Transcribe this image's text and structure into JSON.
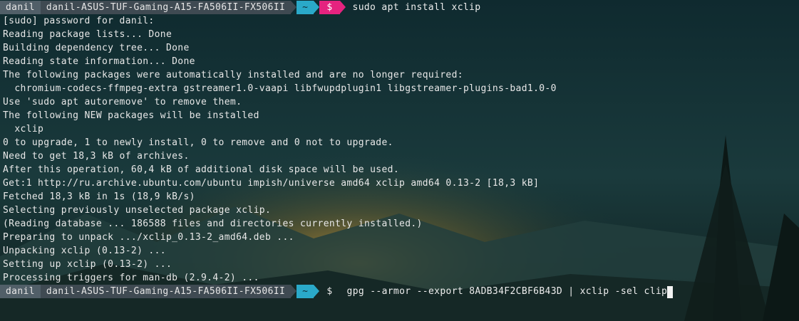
{
  "prompt": {
    "user": "danil",
    "host": "danil-ASUS-TUF-Gaming-A15-FA506II-FX506II",
    "dir": "~",
    "symbol": "$"
  },
  "commands": {
    "first": "sudo apt install xclip",
    "second": "gpg --armor --export 8ADB34F2CBF6B43D | xclip -sel clip"
  },
  "output": [
    "[sudo] password for danil:",
    "Reading package lists... Done",
    "Building dependency tree... Done",
    "Reading state information... Done",
    "The following packages were automatically installed and are no longer required:",
    "  chromium-codecs-ffmpeg-extra gstreamer1.0-vaapi libfwupdplugin1 libgstreamer-plugins-bad1.0-0",
    "Use 'sudo apt autoremove' to remove them.",
    "The following NEW packages will be installed",
    "  xclip",
    "0 to upgrade, 1 to newly install, 0 to remove and 0 not to upgrade.",
    "Need to get 18,3 kB of archives.",
    "After this operation, 60,4 kB of additional disk space will be used.",
    "Get:1 http://ru.archive.ubuntu.com/ubuntu impish/universe amd64 xclip amd64 0.13-2 [18,3 kB]",
    "Fetched 18,3 kB in 1s (18,9 kB/s)",
    "Selecting previously unselected package xclip.",
    "(Reading database ... 186588 files and directories currently installed.)",
    "Preparing to unpack .../xclip_0.13-2_amd64.deb ...",
    "Unpacking xclip (0.13-2) ...",
    "Setting up xclip (0.13-2) ...",
    "Processing triggers for man-db (2.9.4-2) ..."
  ],
  "colors": {
    "user_segment": "#515f68",
    "host_segment": "#3f4a52",
    "dir_segment": "#2aa9c9",
    "error_symbol": "#e5237f",
    "text": "#e8e8e8"
  }
}
